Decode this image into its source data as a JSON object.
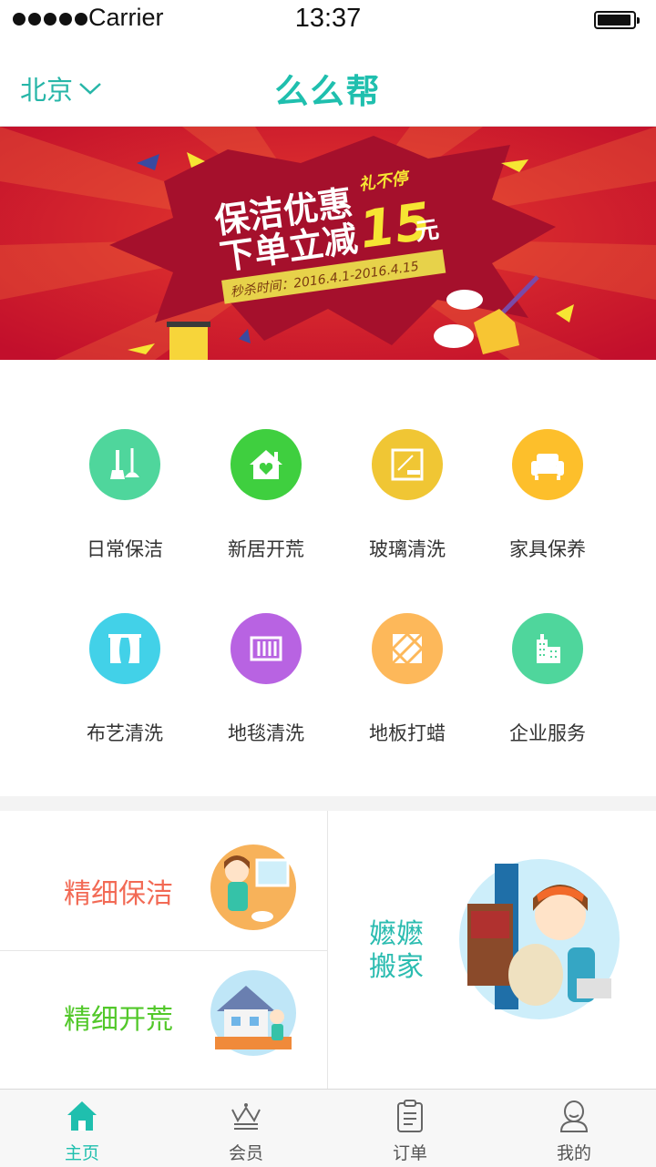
{
  "status_bar": {
    "carrier": "Carrier",
    "time": "13:37"
  },
  "header": {
    "city": "北京",
    "title": "么么帮"
  },
  "banner": {
    "headline_line1": "保洁优惠",
    "headline_line2": "下单立减",
    "tag": "礼不停",
    "amount": "15",
    "unit": "元",
    "period": "秒杀时间：2016.4.1-2016.4.15",
    "page_count": 3,
    "active_page": 1
  },
  "services": [
    {
      "label": "日常保洁",
      "color": "#4fd69c",
      "icon": "broom-icon"
    },
    {
      "label": "新居开荒",
      "color": "#3fcf3f",
      "icon": "house-heart-icon"
    },
    {
      "label": "玻璃清洗",
      "color": "#f0c634",
      "icon": "window-icon"
    },
    {
      "label": "家具保养",
      "color": "#fdbf2b",
      "icon": "sofa-icon"
    },
    {
      "label": "布艺清洗",
      "color": "#42d1e8",
      "icon": "curtain-icon"
    },
    {
      "label": "地毯清洗",
      "color": "#b863e2",
      "icon": "rug-icon"
    },
    {
      "label": "地板打蜡",
      "color": "#fdb85a",
      "icon": "floor-tiles-icon"
    },
    {
      "label": "企业服务",
      "color": "#4fd69c",
      "icon": "building-icon"
    }
  ],
  "promos": {
    "fine_cleaning": {
      "label": "精细保洁",
      "color": "#f26a55"
    },
    "fine_new_home": {
      "label": "精细开荒",
      "color": "#52c82a"
    },
    "moving_line1": "嬷嬷",
    "moving_line2": "搬家",
    "moving_color": "#2bbcb0"
  },
  "tabbar": [
    {
      "label": "主页",
      "icon": "home-icon",
      "active": true
    },
    {
      "label": "会员",
      "icon": "crown-icon",
      "active": false
    },
    {
      "label": "订单",
      "icon": "clipboard-icon",
      "active": false
    },
    {
      "label": "我的",
      "icon": "user-icon",
      "active": false
    }
  ],
  "accent_color": "#1fbfae"
}
